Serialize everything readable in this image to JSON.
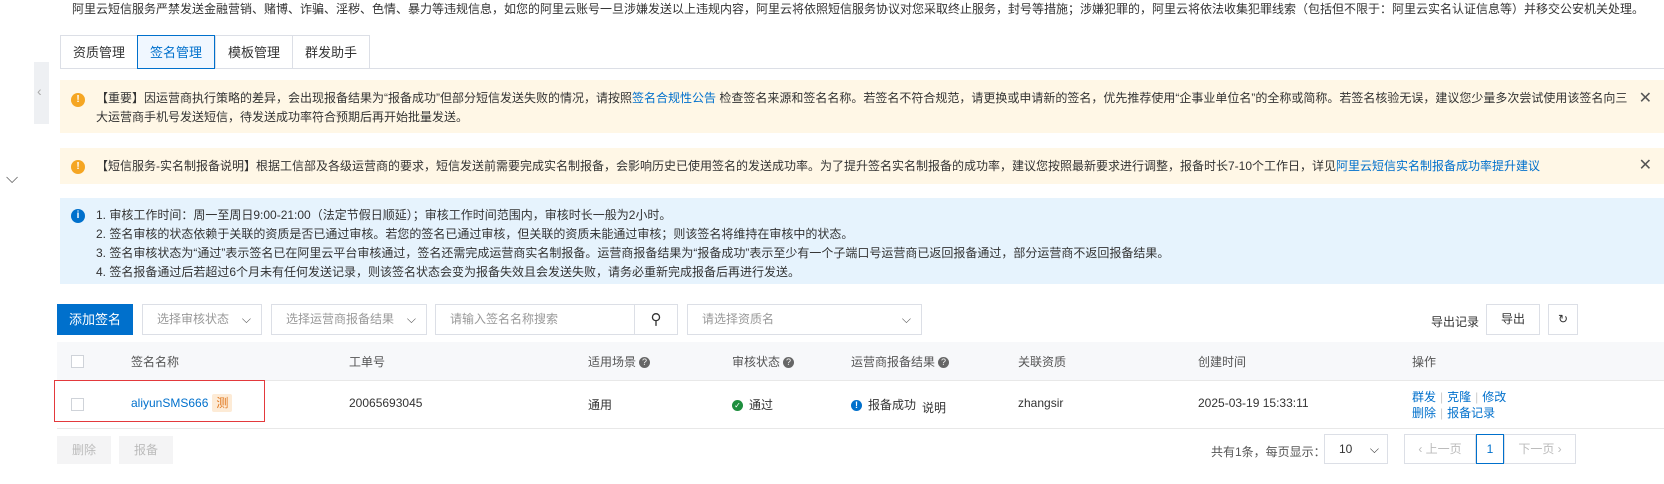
{
  "top_notice": "阿里云短信服务严禁发送金融营销、赌博、诈骗、淫秽、色情、暴力等违规信息，如您的阿里云账号一旦涉嫌发送以上违规内容，阿里云将依照短信服务协议对您采取终止服务，封号等措施；涉嫌犯罪的，阿里云将依法收集犯罪线索（包括但不限于：阿里云实名认证信息等）并移交公安机关处理。",
  "tabs": [
    {
      "label": "资质管理"
    },
    {
      "label": "签名管理"
    },
    {
      "label": "模板管理"
    },
    {
      "label": "群发助手"
    }
  ],
  "notice1": {
    "part1": "【重要】因运营商执行策略的差异，会出现报备结果为“报备成功”但部分短信发送失败的情况，请按照",
    "link": "签名合规性公告",
    "part2": "检查签名来源和签名名称。若签名不符合规范，请更换或申请新的签名，优先推荐使用“企事业单位名”的全称或简称。若签名核验无误，建议您少量多次尝试使用该签名向三大运营商手机号发送短信，待发送成功率符合预期后再开始批量发送。"
  },
  "notice2": {
    "part1": "【短信服务-实名制报备说明】根据工信部及各级运营商的要求，短信发送前需要完成实名制报备，会影响历史已使用签名的发送成功率。为了提升签名实名制报备的成功率，建议您按照最新要求进行调整，报备时长7-10个工作日，详见",
    "link": "阿里云短信实名制报备成功率提升建议"
  },
  "notice3": {
    "lines": [
      "1. 审核工作时间：周一至周日9:00-21:00（法定节假日顺延）；审核工作时间范围内，审核时长一般为2小时。",
      "2. 签名审核的状态依赖于关联的资质是否已通过审核。若您的签名已通过审核，但关联的资质未能通过审核；则该签名将维持在审核中的状态。",
      "3. 签名审核状态为“通过”表示签名已在阿里云平台审核通过，签名还需完成运营商实名制报备。运营商报备结果为“报备成功”表示至少有一个子端口号运营商已返回报备通过，部分运营商不返回报备结果。",
      "4. 签名报备通过后若超过6个月未有任何发送记录，则该签名状态会变为报备失效且会发送失败，请务必重新完成报备后再进行发送。"
    ]
  },
  "toolbar": {
    "add_label": "添加签名",
    "audit_status_placeholder": "选择审核状态",
    "carrier_result_placeholder": "选择运营商报备结果",
    "search_placeholder": "请输入签名名称搜索",
    "qualification_placeholder": "请选择资质名",
    "export_records_label": "导出记录",
    "export_label": "导出"
  },
  "table": {
    "headers": {
      "name": "签名名称",
      "order": "工单号",
      "scene": "适用场景",
      "status": "审核状态",
      "carrier": "运营商报备结果",
      "qualification": "关联资质",
      "created": "创建时间",
      "actions": "操作"
    },
    "rows": [
      {
        "name": "aliyunSMS666",
        "tag": "测",
        "order": "20065693045",
        "scene": "通用",
        "status": "通过",
        "carrier": "报备成功",
        "carrier_link": "说明",
        "qualification": "zhangsir",
        "created": "2025-03-19 15:33:11",
        "actions": [
          "群发",
          "克隆",
          "修改",
          "删除",
          "报备记录"
        ]
      }
    ]
  },
  "bottom": {
    "delete_label": "删除",
    "report_label": "报备",
    "total_text": "共有1条，每页显示：",
    "page_size": "10",
    "prev_label": "上一页",
    "current_page": "1",
    "next_label": "下一页"
  }
}
